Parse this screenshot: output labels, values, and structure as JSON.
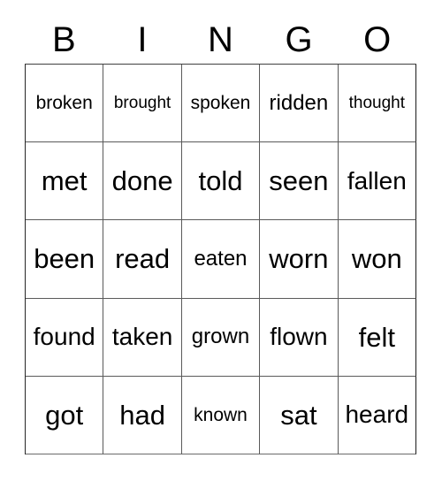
{
  "card": {
    "header_letters": [
      "B",
      "I",
      "N",
      "G",
      "O"
    ],
    "columns": 5,
    "rows": 5,
    "grid": [
      [
        {
          "word": "broken",
          "size": "s"
        },
        {
          "word": "brought",
          "size": "xs"
        },
        {
          "word": "spoken",
          "size": "s"
        },
        {
          "word": "ridden",
          "size": "m"
        },
        {
          "word": "thought",
          "size": "xs"
        }
      ],
      [
        {
          "word": "met",
          "size": "xl"
        },
        {
          "word": "done",
          "size": "xl"
        },
        {
          "word": "told",
          "size": "xl"
        },
        {
          "word": "seen",
          "size": "xl"
        },
        {
          "word": "fallen",
          "size": "l"
        }
      ],
      [
        {
          "word": "been",
          "size": "xl"
        },
        {
          "word": "read",
          "size": "xl"
        },
        {
          "word": "eaten",
          "size": "m"
        },
        {
          "word": "worn",
          "size": "xl"
        },
        {
          "word": "won",
          "size": "xl"
        }
      ],
      [
        {
          "word": "found",
          "size": "l"
        },
        {
          "word": "taken",
          "size": "l"
        },
        {
          "word": "grown",
          "size": "m"
        },
        {
          "word": "flown",
          "size": "l"
        },
        {
          "word": "felt",
          "size": "xl"
        }
      ],
      [
        {
          "word": "got",
          "size": "xl"
        },
        {
          "word": "had",
          "size": "xl"
        },
        {
          "word": "known",
          "size": "s"
        },
        {
          "word": "sat",
          "size": "xl"
        },
        {
          "word": "heard",
          "size": "l"
        }
      ]
    ]
  }
}
